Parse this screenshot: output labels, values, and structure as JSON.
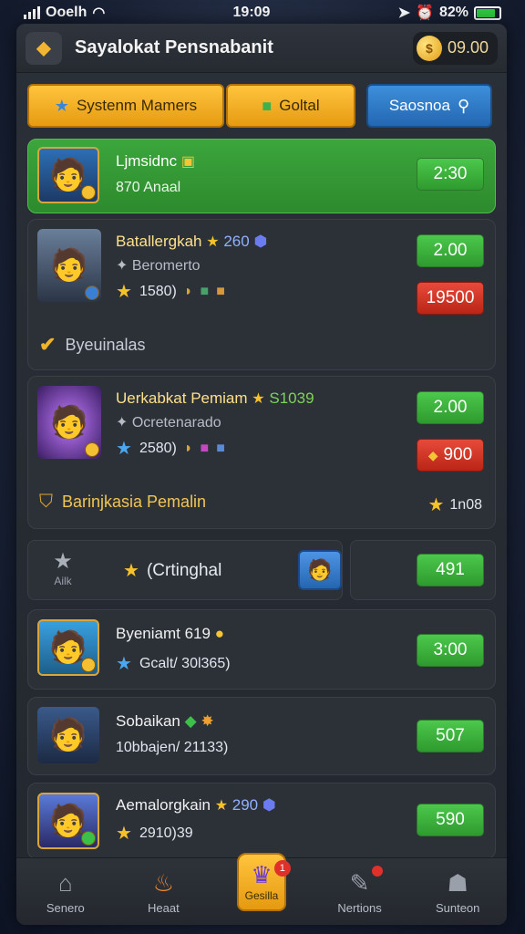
{
  "status": {
    "carrier": "Ooelh",
    "time": "19:09",
    "battery": "82%"
  },
  "header": {
    "title": "Sayalokat Pensnabanit",
    "coins": "09.00"
  },
  "tabs": {
    "tab1": "Systenm Mamers",
    "tab2": "Goltal",
    "search": "Saosnoa"
  },
  "cards": [
    {
      "name": "Ljmsidnc",
      "sub": "870 Anaal",
      "btn": "2:30"
    },
    {
      "name": "Batallergkah",
      "tag": "260",
      "sub": "Beromerto",
      "stats": "1580)",
      "btn1": "2.00",
      "btn2": "19500",
      "footnote": "Byeuinalas"
    },
    {
      "name": "Uerkabkat Pemiam",
      "tag": "S1039",
      "sub": "Ocretenarado",
      "stats": "2580)",
      "btn1": "2.00",
      "btn2": "900",
      "footnote": "Barinjkasia Pemalin",
      "rank": "1n08"
    },
    {
      "name": "Byeniamt 619",
      "stats": "Gcalt/ 30l365)",
      "btn": "3:00"
    },
    {
      "name": "Sobaikan",
      "stats": "10bbajen/ 21133)",
      "btn": "507"
    },
    {
      "name": "Aemalorgkain",
      "tag": "290",
      "stats": "2910)39",
      "btn": "590"
    }
  ],
  "split": {
    "auth": "Ailk",
    "label": "(Crtinghal",
    "value": "491"
  },
  "nav": [
    {
      "label": "Senero",
      "icon": "home-icon"
    },
    {
      "label": "Heaat",
      "icon": "fire-icon"
    },
    {
      "label": "Gesilla",
      "icon": "crown-icon",
      "badge": "1"
    },
    {
      "label": "Nertions",
      "icon": "edit-icon"
    },
    {
      "label": "Sunteon",
      "icon": "profile-icon"
    }
  ],
  "colors": {
    "accent_gold": "#ffc43d",
    "green": "#3ca63c",
    "red": "#e84a3a",
    "blue": "#2f7ad0"
  }
}
